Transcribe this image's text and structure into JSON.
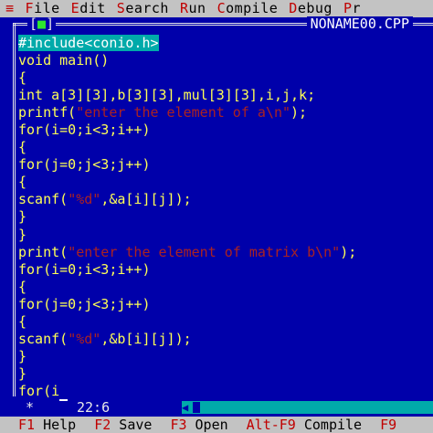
{
  "menu": [
    {
      "label": "≡",
      "hot": true
    },
    {
      "label": "File",
      "hot_first": "F",
      "rest": "ile"
    },
    {
      "label": "Edit",
      "hot_first": "E",
      "rest": "dit"
    },
    {
      "label": "Search",
      "hot_first": "S",
      "rest": "earch"
    },
    {
      "label": "Run",
      "hot_first": "R",
      "rest": "un"
    },
    {
      "label": "Compile",
      "hot_first": "C",
      "rest": "ompile"
    },
    {
      "label": "Debug",
      "hot_first": "D",
      "rest": "ebug"
    },
    {
      "label": "Pr",
      "hot_first": "P",
      "rest": "r"
    }
  ],
  "window": {
    "close_box": "[",
    "close_mark": "■",
    "close_end": "]",
    "filename": "NONAME00.CPP"
  },
  "code_lines": [
    {
      "text": "#include<conio.h>",
      "kind": "hl"
    },
    {
      "text": "void main()"
    },
    {
      "text": "{"
    },
    {
      "text": "int a[3][3],b[3][3],mul[3][3],i,j,k;"
    },
    {
      "pre": "printf(",
      "str": "\"enter the element of a\\n\"",
      "post": ");"
    },
    {
      "text": "for(i=0;i<3;i++)"
    },
    {
      "text": "{"
    },
    {
      "text": "for(j=0;j<3;j++)"
    },
    {
      "text": "{"
    },
    {
      "pre": "scanf(",
      "str": "\"%d\"",
      "post": ",&a[i][j]);"
    },
    {
      "text": "}"
    },
    {
      "text": "}"
    },
    {
      "pre": "print(",
      "str": "\"enter the element of matrix b\\n\"",
      "post": ");"
    },
    {
      "text": "for(i=0;i<3;i++)"
    },
    {
      "text": "{"
    },
    {
      "text": "for(j=0;j<3;j++)"
    },
    {
      "text": "{"
    },
    {
      "pre": "scanf(",
      "str": "\"%d\"",
      "post": ",&b[i][j]);"
    },
    {
      "text": "}"
    },
    {
      "text": "}"
    },
    {
      "text": "for(i",
      "cursor": true
    }
  ],
  "status": {
    "star": "*",
    "position": "22:6"
  },
  "fnkeys": [
    {
      "key": "F1",
      "label": "Help"
    },
    {
      "key": "F2",
      "label": "Save"
    },
    {
      "key": "F3",
      "label": "Open"
    },
    {
      "key": "Alt-F9",
      "label": "Compile"
    },
    {
      "key": "F9",
      "label": ""
    }
  ],
  "colors": {
    "editor_bg": "#0000aa",
    "code_text": "#ffff55",
    "string_text": "#aa2222",
    "menu_bg": "#c3c3c3",
    "hotkey": "#c00000",
    "highlight_bg": "#00aaaa"
  }
}
